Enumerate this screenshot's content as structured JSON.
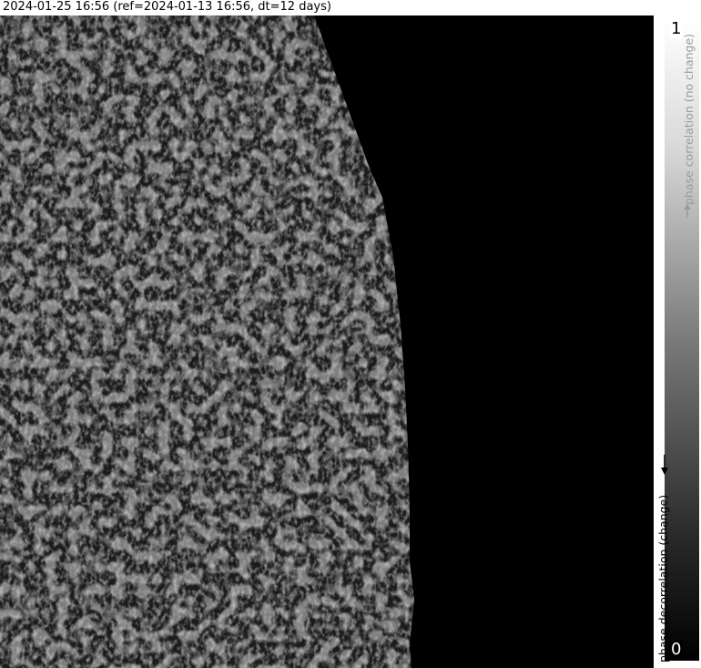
{
  "header": {
    "title": "2024-01-25 16:56 (ref=2024-01-13 16:56, dt=12 days)"
  },
  "map": {
    "background_color": "#000000",
    "texture_color": "#8c8c8c"
  },
  "colorbar": {
    "max_label": "1",
    "min_label": "0",
    "upper_caption": "phase correlation (no change)",
    "lower_caption": "phase decorrelation (change)",
    "gradient_top_color": "#ffffff",
    "gradient_bottom_color": "#000000"
  }
}
